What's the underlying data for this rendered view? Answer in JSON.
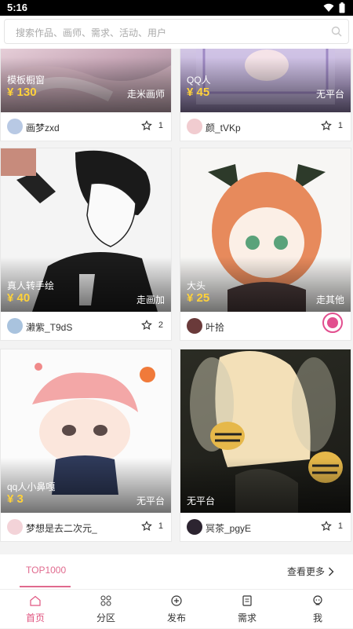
{
  "status": {
    "time": "5:16"
  },
  "search": {
    "placeholder": "搜索作品、画师、需求、活动、用户"
  },
  "cards": [
    {
      "type_name": "模板橱窗",
      "price": "¥ 130",
      "platform": "走米画师",
      "user": "画梦zxd",
      "stars": "1"
    },
    {
      "type_name": "QQ人",
      "price": "¥ 45",
      "platform": "无平台",
      "user": "颜_tVKp",
      "stars": "1"
    },
    {
      "type_name": "真人转手绘",
      "price": "¥ 40",
      "platform": "走画加",
      "user": "濑紫_T9dS",
      "stars": "2"
    },
    {
      "type_name": "大头",
      "price": "¥ 25",
      "platform": "走其他",
      "user": "叶拾",
      "stars": ""
    },
    {
      "type_name": "qq人小鼻嘎",
      "price": "¥ 3",
      "platform": "无平台",
      "user": "梦想是去二次元_",
      "stars": "1"
    },
    {
      "type_name": "",
      "price": "",
      "platform": "无平台",
      "user": "冥茶_pgyE",
      "stars": "1"
    }
  ],
  "section": {
    "tab": "TOP1000",
    "more": "查看更多"
  },
  "tabbar": [
    {
      "label": "首页",
      "icon": "home-icon",
      "active": true
    },
    {
      "label": "分区",
      "icon": "grid-icon"
    },
    {
      "label": "发布",
      "icon": "plus-circle-icon"
    },
    {
      "label": "需求",
      "icon": "document-icon"
    },
    {
      "label": "我",
      "icon": "profile-icon"
    }
  ],
  "colors": {
    "accent": "#e05580",
    "price": "#ffd23a"
  }
}
